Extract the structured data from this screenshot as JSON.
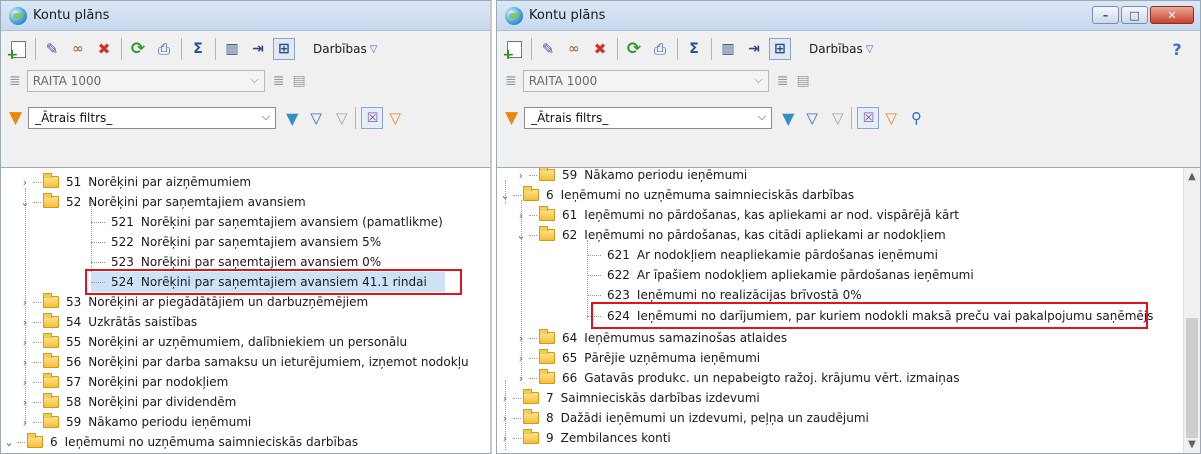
{
  "app": {
    "title": "Kontu plāns"
  },
  "toolbar": {
    "darbibas_label": "Darbības",
    "darbibas_caret": "▽",
    "company_value": "RAITA 1000",
    "filter_value": "_Ātrais filtrs_"
  },
  "colors": {
    "selection": "#cce3f7",
    "highlight_box": "#e0131f",
    "folder": "#f2bf3a"
  },
  "left_tree": {
    "rows": [
      {
        "code": "51",
        "label": "Norēķini par aizņēmumiem",
        "type": "folder",
        "expanded": false
      },
      {
        "code": "52",
        "label": "Norēķini par saņemtajiem avansiem",
        "type": "folder",
        "expanded": true
      },
      {
        "code": "521",
        "label": "Norēķini par saņemtajiem avansiem (pamatlikme)",
        "type": "leaf"
      },
      {
        "code": "522",
        "label": "Norēķini par saņemtajiem avansiem 5%",
        "type": "leaf"
      },
      {
        "code": "523",
        "label": "Norēķini par saņemtajiem avansiem 0%",
        "type": "leaf"
      },
      {
        "code": "524",
        "label": "Norēķini par saņemtajiem avansiem 41.1 rindai",
        "type": "leaf",
        "selected": true,
        "highlighted": true
      },
      {
        "code": "53",
        "label": "Norēķini ar piegādātājiem un darbuzņēmējiem",
        "type": "folder",
        "expanded": false
      },
      {
        "code": "54",
        "label": "Uzkrātās saistības",
        "type": "folder",
        "expanded": false
      },
      {
        "code": "55",
        "label": "Norēķini ar uzņēmumiem, dalībniekiem un personālu",
        "type": "folder",
        "expanded": false
      },
      {
        "code": "56",
        "label": "Norēķini par darba samaksu un ieturējumiem, izņemot nodokļu",
        "type": "folder",
        "expanded": false
      },
      {
        "code": "57",
        "label": "Norēķini par nodokļiem",
        "type": "folder",
        "expanded": false
      },
      {
        "code": "58",
        "label": "Norēķini par dividendēm",
        "type": "folder",
        "expanded": false
      },
      {
        "code": "59",
        "label": "Nākamo periodu ieņēmumi",
        "type": "folder",
        "expanded": false
      },
      {
        "code": "6",
        "label": "Ieņēmumi no uzņēmuma saimnieciskās darbības",
        "type": "folder",
        "expanded": true,
        "level": 0
      }
    ]
  },
  "right_tree": {
    "rows": [
      {
        "code": "59",
        "label": "Nākamo periodu ieņēmumi",
        "type": "folder",
        "expanded": false,
        "level": 1
      },
      {
        "code": "6",
        "label": "Ieņēmumi no uzņēmuma saimnieciskās darbības",
        "type": "folder",
        "expanded": true,
        "level": 0
      },
      {
        "code": "61",
        "label": "Ieņēmumi no pārdošanas, kas apliekami ar nod. vispārējā kārt",
        "type": "folder",
        "expanded": false,
        "level": 1
      },
      {
        "code": "62",
        "label": "Ieņēmumi no pārdošanas, kas citādi apliekami ar nodokļiem",
        "type": "folder",
        "expanded": true,
        "level": 1
      },
      {
        "code": "621",
        "label": "Ar nodokļiem neapliekamie pārdošanas ieņēmumi",
        "type": "leaf",
        "level": 2
      },
      {
        "code": "622",
        "label": "Ar īpašiem nodokļiem apliekamie pārdošanas ieņēmumi",
        "type": "leaf",
        "level": 2
      },
      {
        "code": "623",
        "label": "Ieņēmumi no realizācijas brīvostā 0%",
        "type": "leaf",
        "level": 2
      },
      {
        "code": "624",
        "label": "Ieņēmumi no darījumiem, par kuriem nodokli maksā preču vai pakalpojumu saņēmējs",
        "type": "leaf",
        "level": 2,
        "highlighted": true
      },
      {
        "code": "64",
        "label": "Ieņēmumus samazinošas atlaides",
        "type": "folder",
        "expanded": false,
        "level": 1
      },
      {
        "code": "65",
        "label": "Pārējie uzņēmuma ieņēmumi",
        "type": "folder",
        "expanded": false,
        "level": 1
      },
      {
        "code": "66",
        "label": "Gatavās produkc. un nepabeigto ražoj. krājumu vērt. izmaiņas",
        "type": "folder",
        "expanded": false,
        "level": 1
      },
      {
        "code": "7",
        "label": "Saimnieciskās darbības izdevumi",
        "type": "folder",
        "expanded": false,
        "level": 0
      },
      {
        "code": "8",
        "label": "Dažādi ieņēmumi un izdevumi, peļņa un zaudējumi",
        "type": "folder",
        "expanded": false,
        "level": 0
      },
      {
        "code": "9",
        "label": "Zembilances konti",
        "type": "folder",
        "expanded": false,
        "level": 0
      }
    ]
  }
}
